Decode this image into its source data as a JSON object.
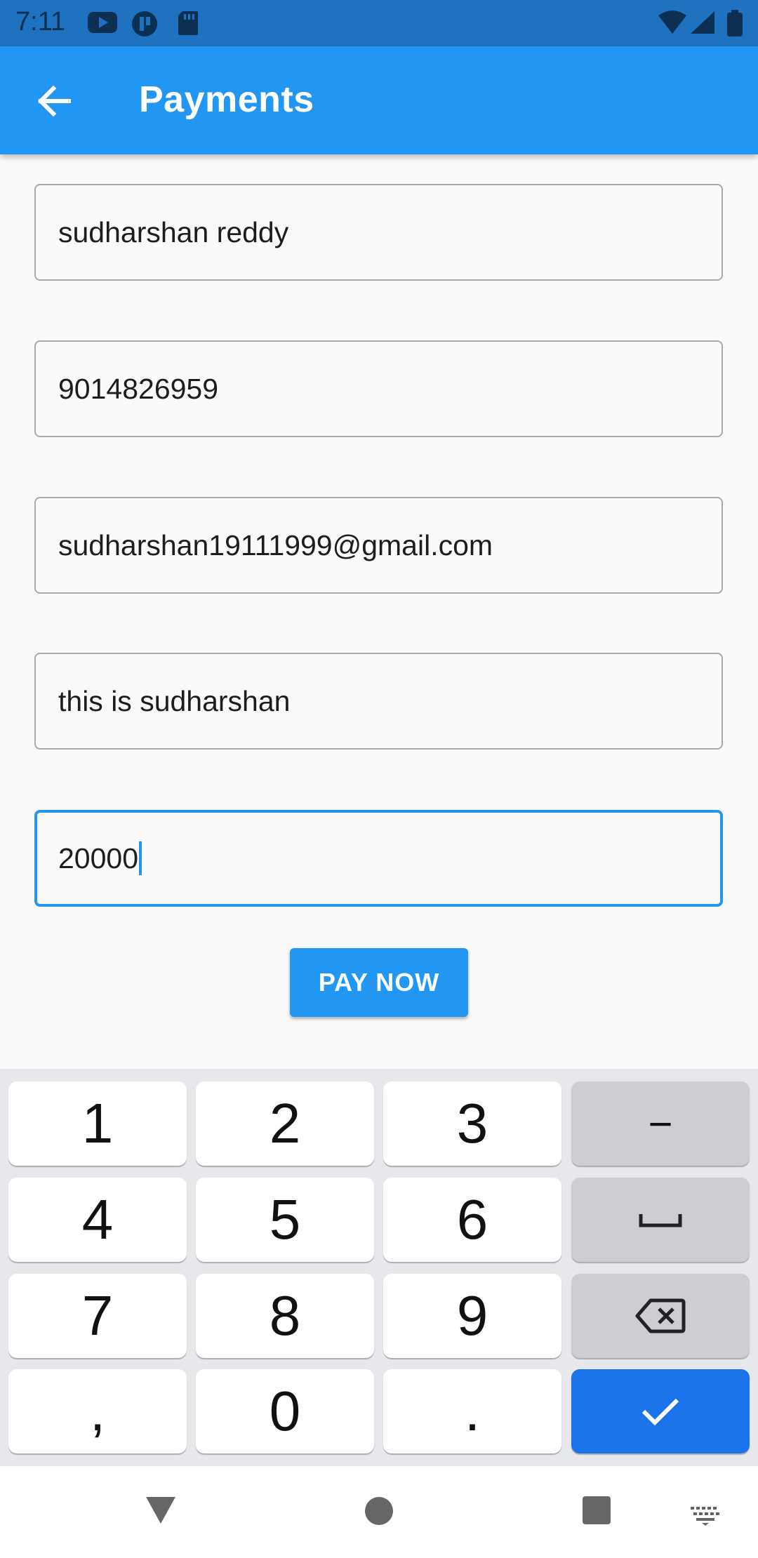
{
  "status_bar": {
    "time": "7:11",
    "icons": [
      "youtube-icon",
      "app-icon",
      "sd-card-icon",
      "wifi-icon",
      "signal-icon",
      "battery-icon"
    ]
  },
  "app_bar": {
    "title": "Payments",
    "back_icon": "arrow-left-icon"
  },
  "form": {
    "name": "sudharshan reddy",
    "phone": "9014826959",
    "email": "sudharshan19111999@gmail.com",
    "description": "this is sudharshan",
    "amount": "20000"
  },
  "pay_button": {
    "label": "PAY NOW"
  },
  "keyboard": {
    "rows": [
      [
        "1",
        "2",
        "3",
        "−"
      ],
      [
        "4",
        "5",
        "6",
        "␣"
      ],
      [
        "7",
        "8",
        "9",
        "⌫"
      ],
      [
        ",",
        "0",
        ".",
        "✓"
      ]
    ]
  },
  "colors": {
    "primary": "#2196f3",
    "status_bar": "#1f72bf",
    "keyboard_enter": "#1a73e8"
  }
}
